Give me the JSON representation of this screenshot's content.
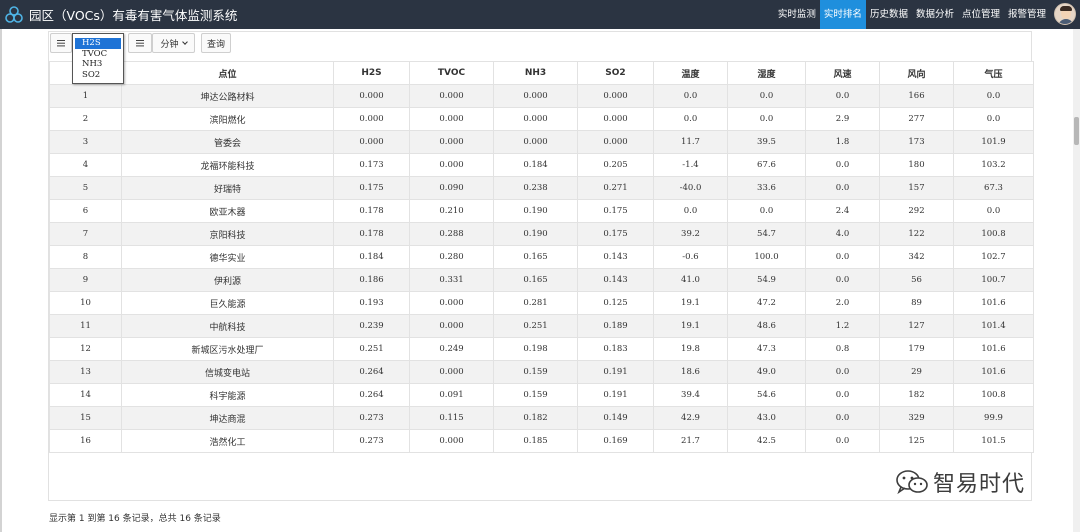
{
  "header": {
    "title": "园区（VOCs）有毒有害气体监测系统",
    "nav": [
      {
        "label": "实时监测",
        "active": false
      },
      {
        "label": "实时排名",
        "active": true
      },
      {
        "label": "历史数据",
        "active": false
      },
      {
        "label": "数据分析",
        "active": false
      },
      {
        "label": "点位管理",
        "active": false
      },
      {
        "label": "报警管理",
        "active": false
      }
    ]
  },
  "toolbar": {
    "pollutant_options": [
      "H2S",
      "TVOC",
      "NH3",
      "SO2"
    ],
    "pollutant_selected": "H2S",
    "interval_label": "分钟",
    "query_label": "查询"
  },
  "table": {
    "columns": [
      "",
      "点位",
      "H2S",
      "TVOC",
      "NH3",
      "SO2",
      "温度",
      "湿度",
      "风速",
      "风向",
      "气压"
    ],
    "rows": [
      [
        "1",
        "坤达公路材料",
        "0.000",
        "0.000",
        "0.000",
        "0.000",
        "0.0",
        "0.0",
        "0.0",
        "166",
        "0.0"
      ],
      [
        "2",
        "滨阳燃化",
        "0.000",
        "0.000",
        "0.000",
        "0.000",
        "0.0",
        "0.0",
        "2.9",
        "277",
        "0.0"
      ],
      [
        "3",
        "管委会",
        "0.000",
        "0.000",
        "0.000",
        "0.000",
        "11.7",
        "39.5",
        "1.8",
        "173",
        "101.9"
      ],
      [
        "4",
        "龙福环能科技",
        "0.173",
        "0.000",
        "0.184",
        "0.205",
        "-1.4",
        "67.6",
        "0.0",
        "180",
        "103.2"
      ],
      [
        "5",
        "好瑞特",
        "0.175",
        "0.090",
        "0.238",
        "0.271",
        "-40.0",
        "33.6",
        "0.0",
        "157",
        "67.3"
      ],
      [
        "6",
        "欧亚木器",
        "0.178",
        "0.210",
        "0.190",
        "0.175",
        "0.0",
        "0.0",
        "2.4",
        "292",
        "0.0"
      ],
      [
        "7",
        "京阳科技",
        "0.178",
        "0.288",
        "0.190",
        "0.175",
        "39.2",
        "54.7",
        "4.0",
        "122",
        "100.8"
      ],
      [
        "8",
        "德华实业",
        "0.184",
        "0.280",
        "0.165",
        "0.143",
        "-0.6",
        "100.0",
        "0.0",
        "342",
        "102.7"
      ],
      [
        "9",
        "伊利源",
        "0.186",
        "0.331",
        "0.165",
        "0.143",
        "41.0",
        "54.9",
        "0.0",
        "56",
        "100.7"
      ],
      [
        "10",
        "巨久能源",
        "0.193",
        "0.000",
        "0.281",
        "0.125",
        "19.1",
        "47.2",
        "2.0",
        "89",
        "101.6"
      ],
      [
        "11",
        "中航科技",
        "0.239",
        "0.000",
        "0.251",
        "0.189",
        "19.1",
        "48.6",
        "1.2",
        "127",
        "101.4"
      ],
      [
        "12",
        "新城区污水处理厂",
        "0.251",
        "0.249",
        "0.198",
        "0.183",
        "19.8",
        "47.3",
        "0.8",
        "179",
        "101.6"
      ],
      [
        "13",
        "信城变电站",
        "0.264",
        "0.000",
        "0.159",
        "0.191",
        "18.6",
        "49.0",
        "0.0",
        "29",
        "101.6"
      ],
      [
        "14",
        "科宇能源",
        "0.264",
        "0.091",
        "0.159",
        "0.191",
        "39.4",
        "54.6",
        "0.0",
        "182",
        "100.8"
      ],
      [
        "15",
        "坤达商混",
        "0.273",
        "0.115",
        "0.182",
        "0.149",
        "42.9",
        "43.0",
        "0.0",
        "329",
        "99.9"
      ],
      [
        "16",
        "浩然化工",
        "0.273",
        "0.000",
        "0.185",
        "0.169",
        "21.7",
        "42.5",
        "0.0",
        "125",
        "101.5"
      ]
    ]
  },
  "footer": {
    "summary": "显示第 1 到第 16 条记录，总共 16 条记录"
  },
  "watermark": {
    "text": "智易时代"
  },
  "colors": {
    "navbar_bg": "#2b3442",
    "nav_active_bg": "#1f8fdd",
    "dropdown_selected_bg": "#1e73d6",
    "row_stripe": "#f2f2f2"
  },
  "icons": {
    "logo": "molecule-logo-icon",
    "list_toggle": "bars-icon",
    "dropdown": "chevron-down-icon",
    "avatar": "user-avatar",
    "watermark": "wechat-icon"
  }
}
